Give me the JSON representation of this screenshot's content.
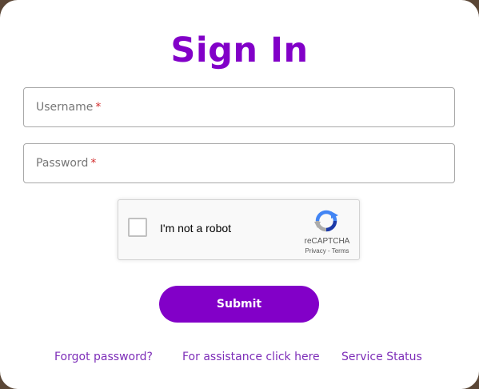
{
  "form": {
    "title": "Sign In",
    "username": {
      "label": "Username",
      "required_mark": "*",
      "value": ""
    },
    "password": {
      "label": "Password",
      "required_mark": "*",
      "value": ""
    },
    "submit_label": "Submit"
  },
  "captcha": {
    "checkbox_label": "I'm not a robot",
    "checked": false,
    "brand": "reCAPTCHA",
    "privacy_label": "Privacy",
    "separator": "-",
    "terms_label": "Terms",
    "icon": "recaptcha-logo-icon"
  },
  "footer_links": {
    "forgot": "Forgot password?",
    "assistance": "For assistance click here",
    "status": "Service Status"
  },
  "colors": {
    "accent": "#8200c8",
    "link": "#7d2db8",
    "required": "#d32f2f",
    "field_border": "#a8a8a8"
  }
}
